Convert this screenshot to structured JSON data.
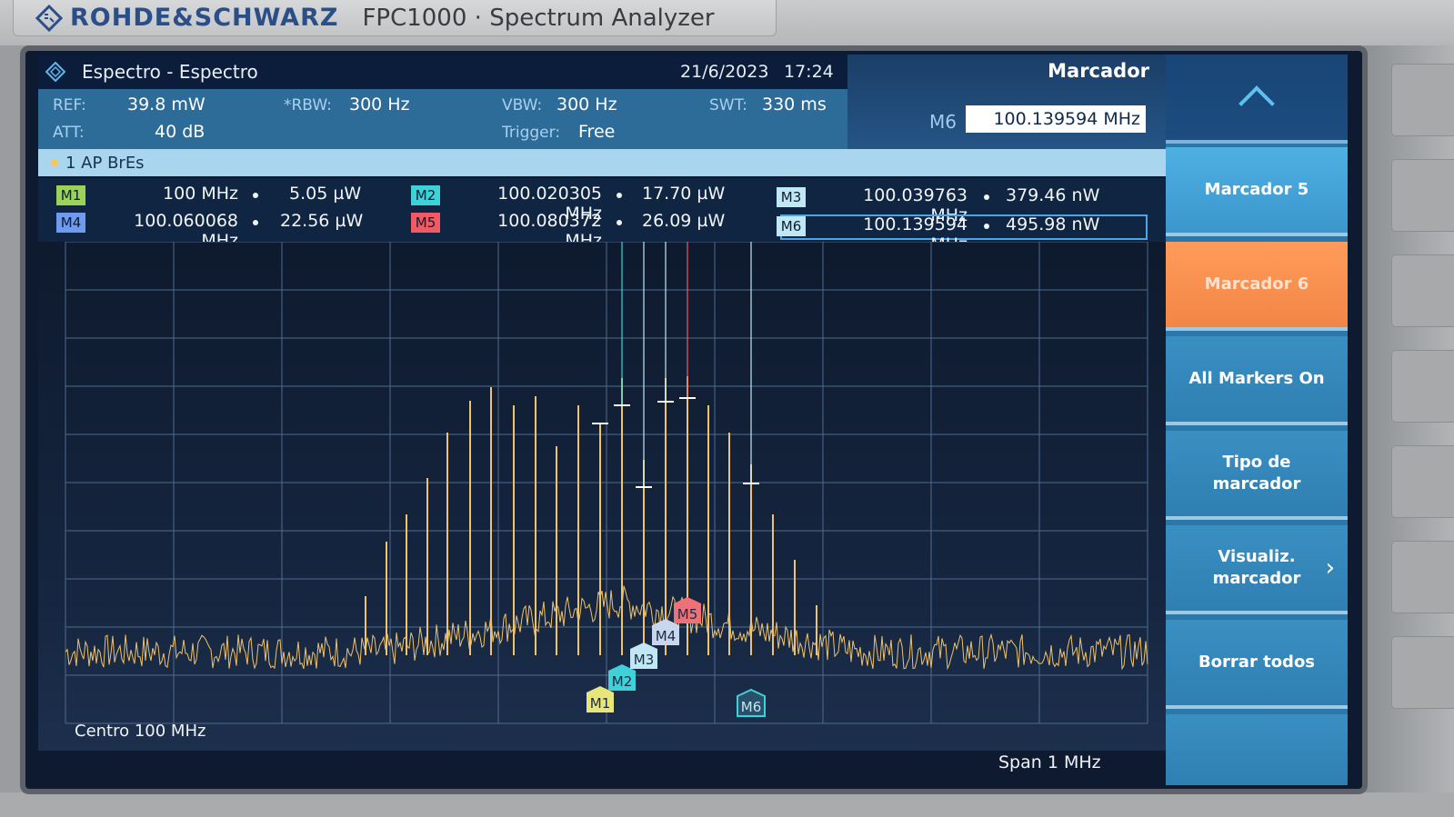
{
  "brand": {
    "name": "ROHDE&SCHWARZ",
    "model": "FPC1000 · Spectrum Analyzer"
  },
  "window": {
    "title": "Espectro - Espectro",
    "date": "21/6/2023",
    "time": "17:24"
  },
  "params": {
    "ref_label": "REF:",
    "ref_value": "39.8 mW",
    "att_label": "ATT:",
    "att_value": "40 dB",
    "rbw_label": "*RBW:",
    "rbw_value": "300 Hz",
    "vbw_label": "VBW:",
    "vbw_value": "300 Hz",
    "trigger_label": "Trigger:",
    "trigger_value": "Free",
    "swt_label": "SWT:",
    "swt_value": "330 ms"
  },
  "marker_panel": {
    "title": "Marcador",
    "active_label": "M6",
    "active_value": "100.139594 MHz"
  },
  "trace_info": "1 AP  BrEs",
  "markers": [
    {
      "id": "M1",
      "freq": "100 MHz",
      "power": "5.05 µW",
      "color": "#9bd35a"
    },
    {
      "id": "M2",
      "freq": "100.020305 MHz",
      "power": "17.70 µW",
      "color": "#3fd1d8"
    },
    {
      "id": "M3",
      "freq": "100.039763 MHz",
      "power": "379.46 nW",
      "color": "#bfe8f4"
    },
    {
      "id": "M4",
      "freq": "100.060068 MHz",
      "power": "22.56 µW",
      "color": "#6e9bf0"
    },
    {
      "id": "M5",
      "freq": "100.080372 MHz",
      "power": "26.09 µW",
      "color": "#f05a64"
    },
    {
      "id": "M6",
      "freq": "100.139594 MHz",
      "power": "495.98 nW",
      "color": "#bfe8f4"
    }
  ],
  "plot": {
    "center": "Centro 100 MHz",
    "span": "Span 1 MHz",
    "trace_color": "#f0c26a"
  },
  "softkeys": {
    "marker5": "Marcador 5",
    "marker6": "Marcador 6",
    "all_on": "All Markers On",
    "type": "Tipo de\nmarcador",
    "view": "Visualiz.\nmarcador",
    "clear": "Borrar todos"
  }
}
